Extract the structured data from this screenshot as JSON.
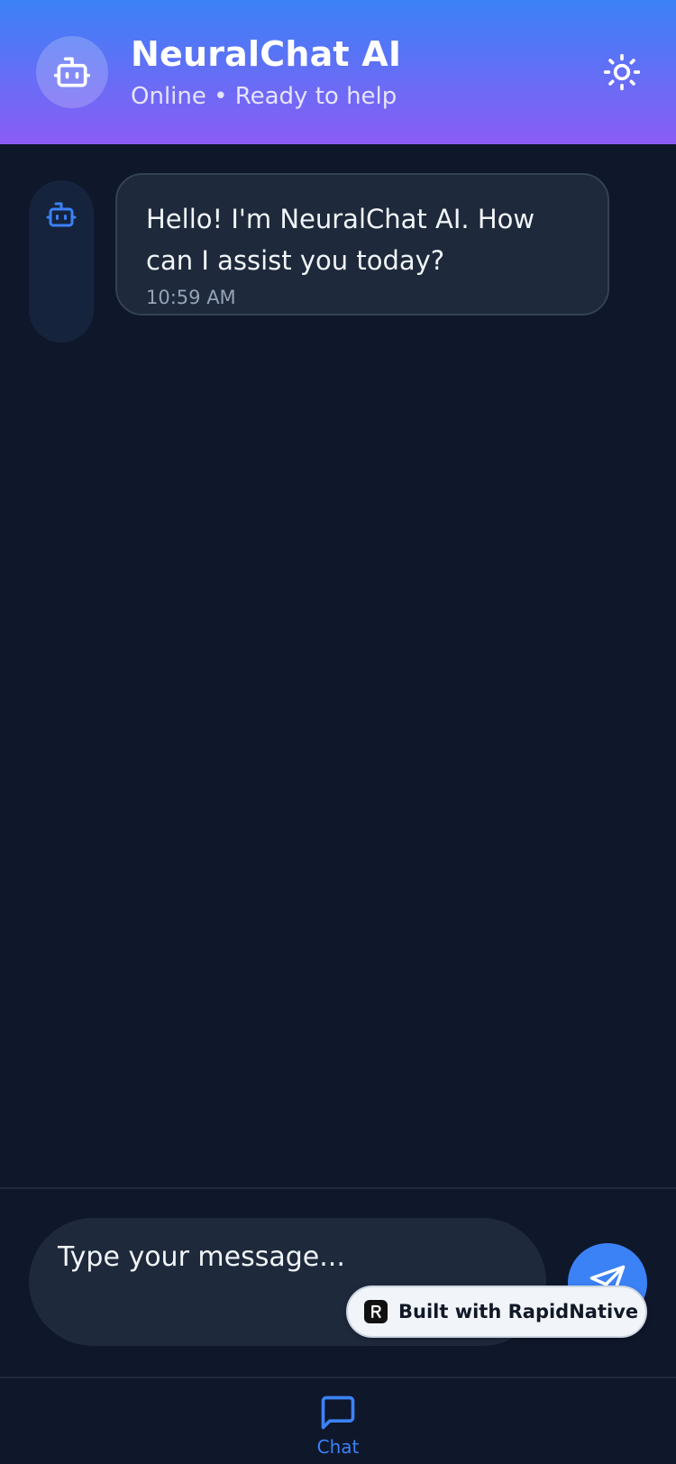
{
  "header": {
    "title": "NeuralChat AI",
    "subtitle": "Online • Ready to help",
    "avatar_icon": "robot-icon",
    "theme_icon": "sun-icon"
  },
  "messages": [
    {
      "sender": "bot",
      "text": "Hello! I'm NeuralChat AI. How can I assist you today?",
      "time": "10:59 AM"
    }
  ],
  "composer": {
    "placeholder": "Type your message...",
    "value": "",
    "send_icon": "send-icon"
  },
  "badge": {
    "label": "Built with RapidNative"
  },
  "tabs": [
    {
      "label": "Chat",
      "icon": "chat-bubble-icon",
      "active": true
    }
  ],
  "colors": {
    "accent": "#3b82f6",
    "header_gradient_start": "#3b82f6",
    "header_gradient_end": "#8b5cf6",
    "background": "#0f172a",
    "bubble": "#1e293b"
  }
}
